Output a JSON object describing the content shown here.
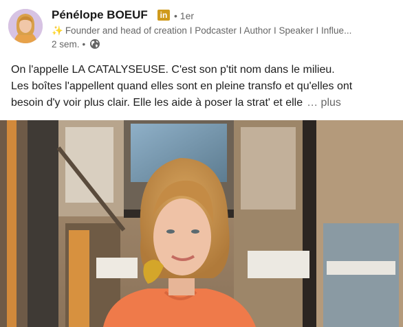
{
  "author": {
    "name": "Pénélope BOEUF",
    "badge": "in",
    "degree": "• 1er",
    "headline_icon": "sparkle-icon",
    "headline": "Founder and head of creation I Podcaster I Author I Speaker I Influe...",
    "time": "2 sem.",
    "separator": "•",
    "visibility_icon": "globe-icon"
  },
  "post": {
    "lines": [
      "On l'appelle LA CATALYSEUSE. C'est son p'tit nom dans le milieu.",
      "Les boîtes l'appellent quand elles sont en pleine transfo et qu'elles ont",
      "besoin d'y voir plus clair. Elle les aide à poser la strat' et elle"
    ],
    "more_label": "… plus"
  },
  "colors": {
    "text": "#191919",
    "muted": "#666666",
    "linkedin_badge": "#cf9a1c"
  }
}
